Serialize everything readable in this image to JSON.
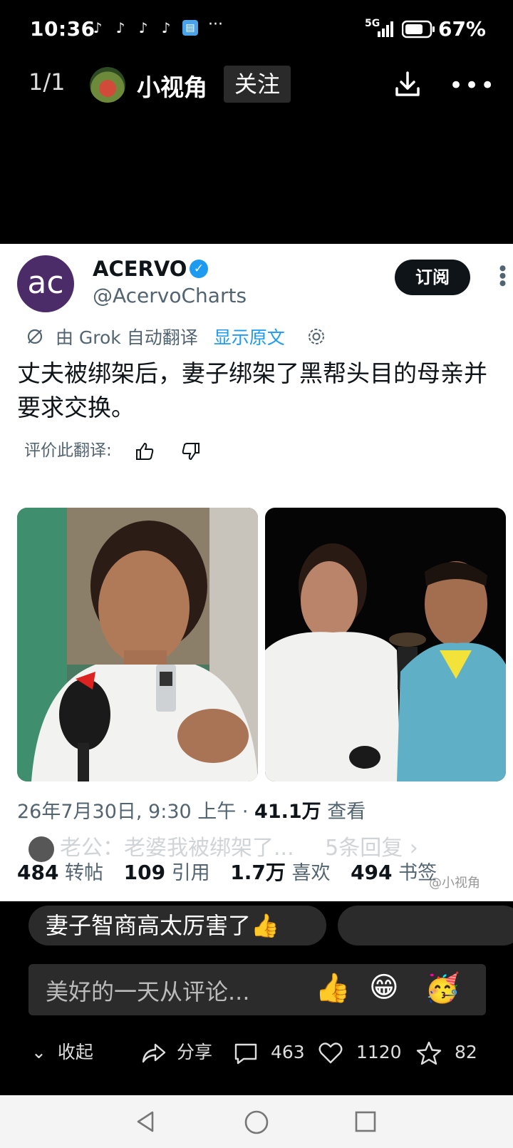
{
  "status_bar": {
    "time": "10:36",
    "network": "5G",
    "battery": "67%"
  },
  "header": {
    "counter": "1/1",
    "username": "小视角",
    "follow_label": "关注"
  },
  "post": {
    "account_name": "ACERVO",
    "handle": "@AcervoCharts",
    "logo_text": "ac",
    "subscribe_label": "订阅",
    "translation_note": "由 Grok 自动翻译",
    "show_original": "显示原文",
    "text": "丈夫被绑架后，妻子绑架了黑帮头目的母亲并要求交换。",
    "rate_label": "评价此翻译:",
    "meta_date": "26年7月30日, 9:30 上午 · ",
    "meta_views_num": "41.1万",
    "meta_views_label": " 查看",
    "reply_preview": "老公：老婆我被绑架了...",
    "reply_count": "5条回复",
    "stats": {
      "reposts_num": "484",
      "reposts_label": "转帖",
      "quotes_num": "109",
      "quotes_label": "引用",
      "likes_num": "1.7万",
      "likes_label": "喜欢",
      "bookmarks_num": "494",
      "bookmarks_label": "书签"
    },
    "watermark": "@小视角"
  },
  "comments": {
    "chip1": "妻子智商高太厉害了👍",
    "placeholder": "美好的一天从评论..."
  },
  "actions": {
    "collapse": "收起",
    "share": "分享",
    "comment_count": "463",
    "like_count": "1120",
    "star_count": "82"
  }
}
